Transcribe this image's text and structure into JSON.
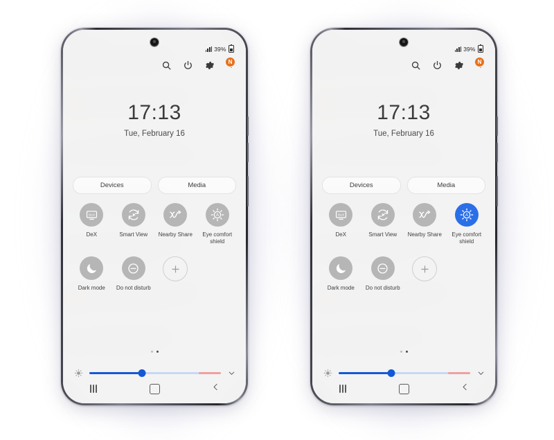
{
  "scene": {
    "description": "Android quick settings panel shown on two Samsung phones side by side",
    "accent_blue": "#2b6fe8",
    "slider_blue": "#1558d6",
    "badge_orange": "#e8711a",
    "tile_gray": "#b6b6b6"
  },
  "statusbar": {
    "battery_percent": "39%",
    "signal_icon": "signal-bars-icon",
    "battery_icon": "battery-icon"
  },
  "header": {
    "search_icon": "search-icon",
    "power_icon": "power-icon",
    "settings_icon": "gear-icon",
    "menu_icon": "more-options-icon",
    "badge_label": "N"
  },
  "clock": {
    "time": "17:13",
    "date": "Tue, February 16"
  },
  "shortcuts": {
    "devices_label": "Devices",
    "media_label": "Media"
  },
  "tiles_row1": [
    {
      "label": "DeX",
      "icon": "dex-icon",
      "active": false
    },
    {
      "label": "Smart View",
      "icon": "smart-view-icon",
      "active": false
    },
    {
      "label": "Nearby Share",
      "icon": "nearby-share-icon",
      "active": false
    },
    {
      "label": "Eye comfort shield",
      "icon": "eye-comfort-shield-icon",
      "active": false
    }
  ],
  "tiles_row2": [
    {
      "label": "Dark mode",
      "icon": "moon-icon",
      "active": false
    },
    {
      "label": "Do not disturb",
      "icon": "do-not-disturb-icon",
      "active": false
    },
    {
      "label": "",
      "icon": "add-icon",
      "active": false
    }
  ],
  "tiles_row1_right": [
    {
      "label": "DeX",
      "icon": "dex-icon",
      "active": false
    },
    {
      "label": "Smart View",
      "icon": "smart-view-icon",
      "active": false
    },
    {
      "label": "Nearby Share",
      "icon": "nearby-share-icon",
      "active": false
    },
    {
      "label": "Eye comfort shield",
      "icon": "eye-comfort-shield-icon",
      "active": true
    }
  ],
  "tiles_row2_right": [
    {
      "label": "Dark mode",
      "icon": "moon-icon",
      "active": false
    },
    {
      "label": "Do not disturb",
      "icon": "do-not-disturb-icon",
      "active": false
    },
    {
      "label": "",
      "icon": "add-icon",
      "active": false
    }
  ],
  "brightness": {
    "auto_icon": "brightness-sun-icon",
    "expand_icon": "chevron-down-icon",
    "value_percent": 40
  },
  "pages": {
    "count": 2,
    "current": 2
  },
  "navbar": {
    "recents_icon": "recents-icon",
    "home_icon": "home-icon",
    "back_icon": "back-icon"
  }
}
